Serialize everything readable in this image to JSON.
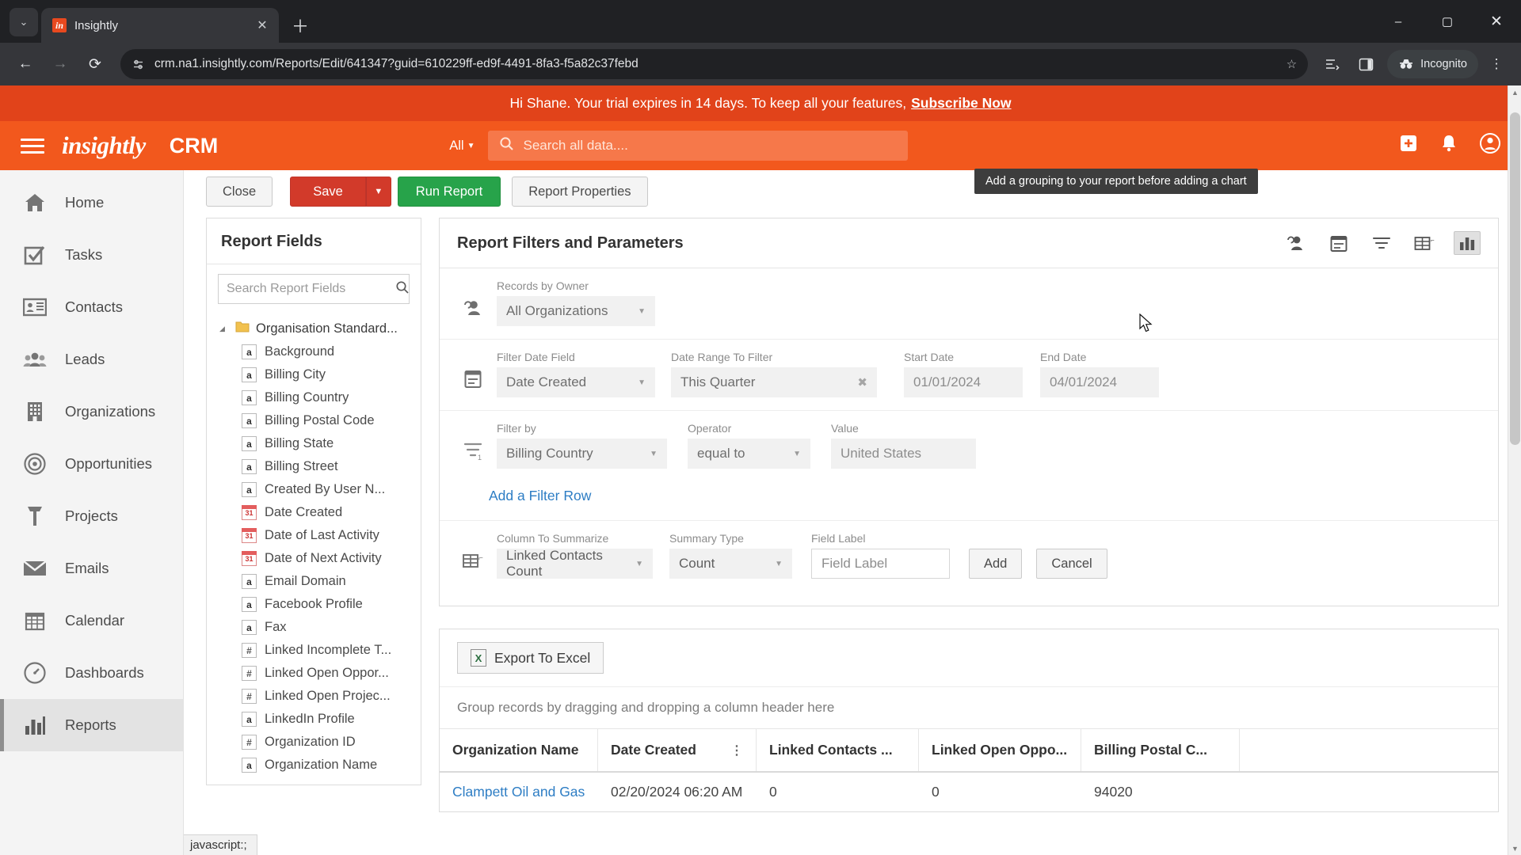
{
  "browser": {
    "tab": {
      "title": "Insightly",
      "favicon_label": "in",
      "close_icon": "close-icon"
    },
    "new_tab_icon": "plus-icon",
    "tab_list_icon": "chevron-down-icon",
    "window": {
      "minimize": "–",
      "maximize": "▢",
      "close": "✕"
    },
    "nav": {
      "back": "←",
      "forward": "→",
      "reload": "⟳"
    },
    "omnibox": {
      "url": "crm.na1.insightly.com/Reports/Edit/641347?guid=610229ff-ed9f-4491-8fa3-f5a82c37febd",
      "site_info_icon": "site-settings-icon",
      "bookmark_icon": "star-icon"
    },
    "toolbar_icons": [
      "reading-list-icon",
      "side-panel-icon"
    ],
    "incognito_label": "Incognito",
    "menu_icon": "kebab-menu-icon"
  },
  "banner": {
    "message": "Hi Shane. Your trial expires in 14 days. To keep all your features,",
    "link": "Subscribe Now"
  },
  "tooltip": {
    "text": "Add a grouping to your report before adding a chart"
  },
  "app_header": {
    "brand": "insightly",
    "product": "CRM",
    "search_scope": "All",
    "search_placeholder": "Search all data....",
    "add_icon": "plus-square-icon",
    "bell_icon": "bell-icon",
    "account_icon": "user-avatar-icon"
  },
  "sidebar": {
    "items": [
      {
        "label": "Home",
        "icon": "home-icon",
        "active": false
      },
      {
        "label": "Tasks",
        "icon": "checkbox-check-icon",
        "active": false
      },
      {
        "label": "Contacts",
        "icon": "contact-card-icon",
        "active": false
      },
      {
        "label": "Leads",
        "icon": "people-icon",
        "active": false
      },
      {
        "label": "Organizations",
        "icon": "building-icon",
        "active": false
      },
      {
        "label": "Opportunities",
        "icon": "target-icon",
        "active": false
      },
      {
        "label": "Projects",
        "icon": "hammer-icon",
        "active": false
      },
      {
        "label": "Emails",
        "icon": "envelope-icon",
        "active": false
      },
      {
        "label": "Calendar",
        "icon": "calendar-icon",
        "active": false
      },
      {
        "label": "Dashboards",
        "icon": "gauge-icon",
        "active": false
      },
      {
        "label": "Reports",
        "icon": "bar-chart-icon",
        "active": true
      }
    ]
  },
  "actions": {
    "close": "Close",
    "save": "Save",
    "save_caret": "▼",
    "run_report": "Run Report",
    "report_properties": "Report Properties"
  },
  "report_fields": {
    "title": "Report Fields",
    "search_placeholder": "Search Report Fields",
    "search_value": "",
    "search_icon": "search-icon",
    "root": {
      "label": "Organisation Standard...",
      "caret": "◢",
      "folder_icon": "folder-icon"
    },
    "items": [
      {
        "label": "Background",
        "type": "a"
      },
      {
        "label": "Billing City",
        "type": "a"
      },
      {
        "label": "Billing Country",
        "type": "a"
      },
      {
        "label": "Billing Postal Code",
        "type": "a"
      },
      {
        "label": "Billing State",
        "type": "a"
      },
      {
        "label": "Billing Street",
        "type": "a"
      },
      {
        "label": "Created By User N...",
        "type": "a"
      },
      {
        "label": "Date Created",
        "type": "date"
      },
      {
        "label": "Date of Last Activity",
        "type": "date"
      },
      {
        "label": "Date of Next Activity",
        "type": "date"
      },
      {
        "label": "Email Domain",
        "type": "a"
      },
      {
        "label": "Facebook Profile",
        "type": "a"
      },
      {
        "label": "Fax",
        "type": "a"
      },
      {
        "label": "Linked Incomplete T...",
        "type": "num"
      },
      {
        "label": "Linked Open Oppor...",
        "type": "num"
      },
      {
        "label": "Linked Open Projec...",
        "type": "num"
      },
      {
        "label": "LinkedIn Profile",
        "type": "a"
      },
      {
        "label": "Organization ID",
        "type": "num"
      },
      {
        "label": "Organization Name",
        "type": "a"
      }
    ]
  },
  "filters": {
    "title": "Report Filters and Parameters",
    "header_icons": [
      {
        "name": "records-by-owner-icon",
        "glyph": "owner",
        "active": false
      },
      {
        "name": "date-filter-icon",
        "glyph": "calendar",
        "active": false
      },
      {
        "name": "filter-icon",
        "glyph": "funnel",
        "active": false
      },
      {
        "name": "summarize-icon",
        "glyph": "table",
        "active": false
      },
      {
        "name": "chart-icon",
        "glyph": "chart",
        "active": true
      }
    ],
    "owner_row": {
      "icon": "owner-icon",
      "label": "Records by Owner",
      "value": "All Organizations"
    },
    "date_row": {
      "icon": "calendar-icon",
      "fields": [
        {
          "label": "Filter Date Field",
          "value": "Date Created",
          "kind": "select"
        },
        {
          "label": "Date Range To Filter",
          "value": "This Quarter",
          "kind": "clearable"
        },
        {
          "label": "Start Date",
          "value": "01/01/2024",
          "kind": "flat"
        },
        {
          "label": "End Date",
          "value": "04/01/2024",
          "kind": "flat"
        }
      ]
    },
    "filter_row": {
      "icon": "funnel-icon",
      "fields": [
        {
          "label": "Filter by",
          "value": "Billing Country",
          "kind": "select"
        },
        {
          "label": "Operator",
          "value": "equal to",
          "kind": "select"
        },
        {
          "label": "Value",
          "value": "United States",
          "kind": "flat"
        }
      ]
    },
    "add_filter_row_link": "Add a Filter Row",
    "summarize_row": {
      "icon": "table-icon",
      "fields": [
        {
          "label": "Column To Summarize",
          "value": "Linked Contacts Count",
          "kind": "select"
        },
        {
          "label": "Summary Type",
          "value": "Count",
          "kind": "select"
        }
      ],
      "field_label": {
        "label": "Field Label",
        "placeholder": "Field Label",
        "value": ""
      },
      "add_button": "Add",
      "cancel_button": "Cancel"
    }
  },
  "results": {
    "export_button": "Export To Excel",
    "export_icon": "excel-icon",
    "group_hint": "Group records by dragging and dropping a column header here",
    "columns": [
      "Organization Name",
      "Date Created",
      "Linked Contacts ...",
      "Linked Open Oppo...",
      "Billing Postal C..."
    ],
    "rows": [
      [
        "Clampett Oil and Gas",
        "02/20/2024 06:20 AM",
        "0",
        "0",
        "94020"
      ]
    ]
  },
  "status_bar": {
    "text": "javascript:;"
  },
  "colors": {
    "brand_orange": "#f2581d",
    "banner_orange": "#e1431a",
    "save_red": "#d23a2a",
    "run_green": "#27a34a",
    "link_blue": "#2d7dc4"
  }
}
